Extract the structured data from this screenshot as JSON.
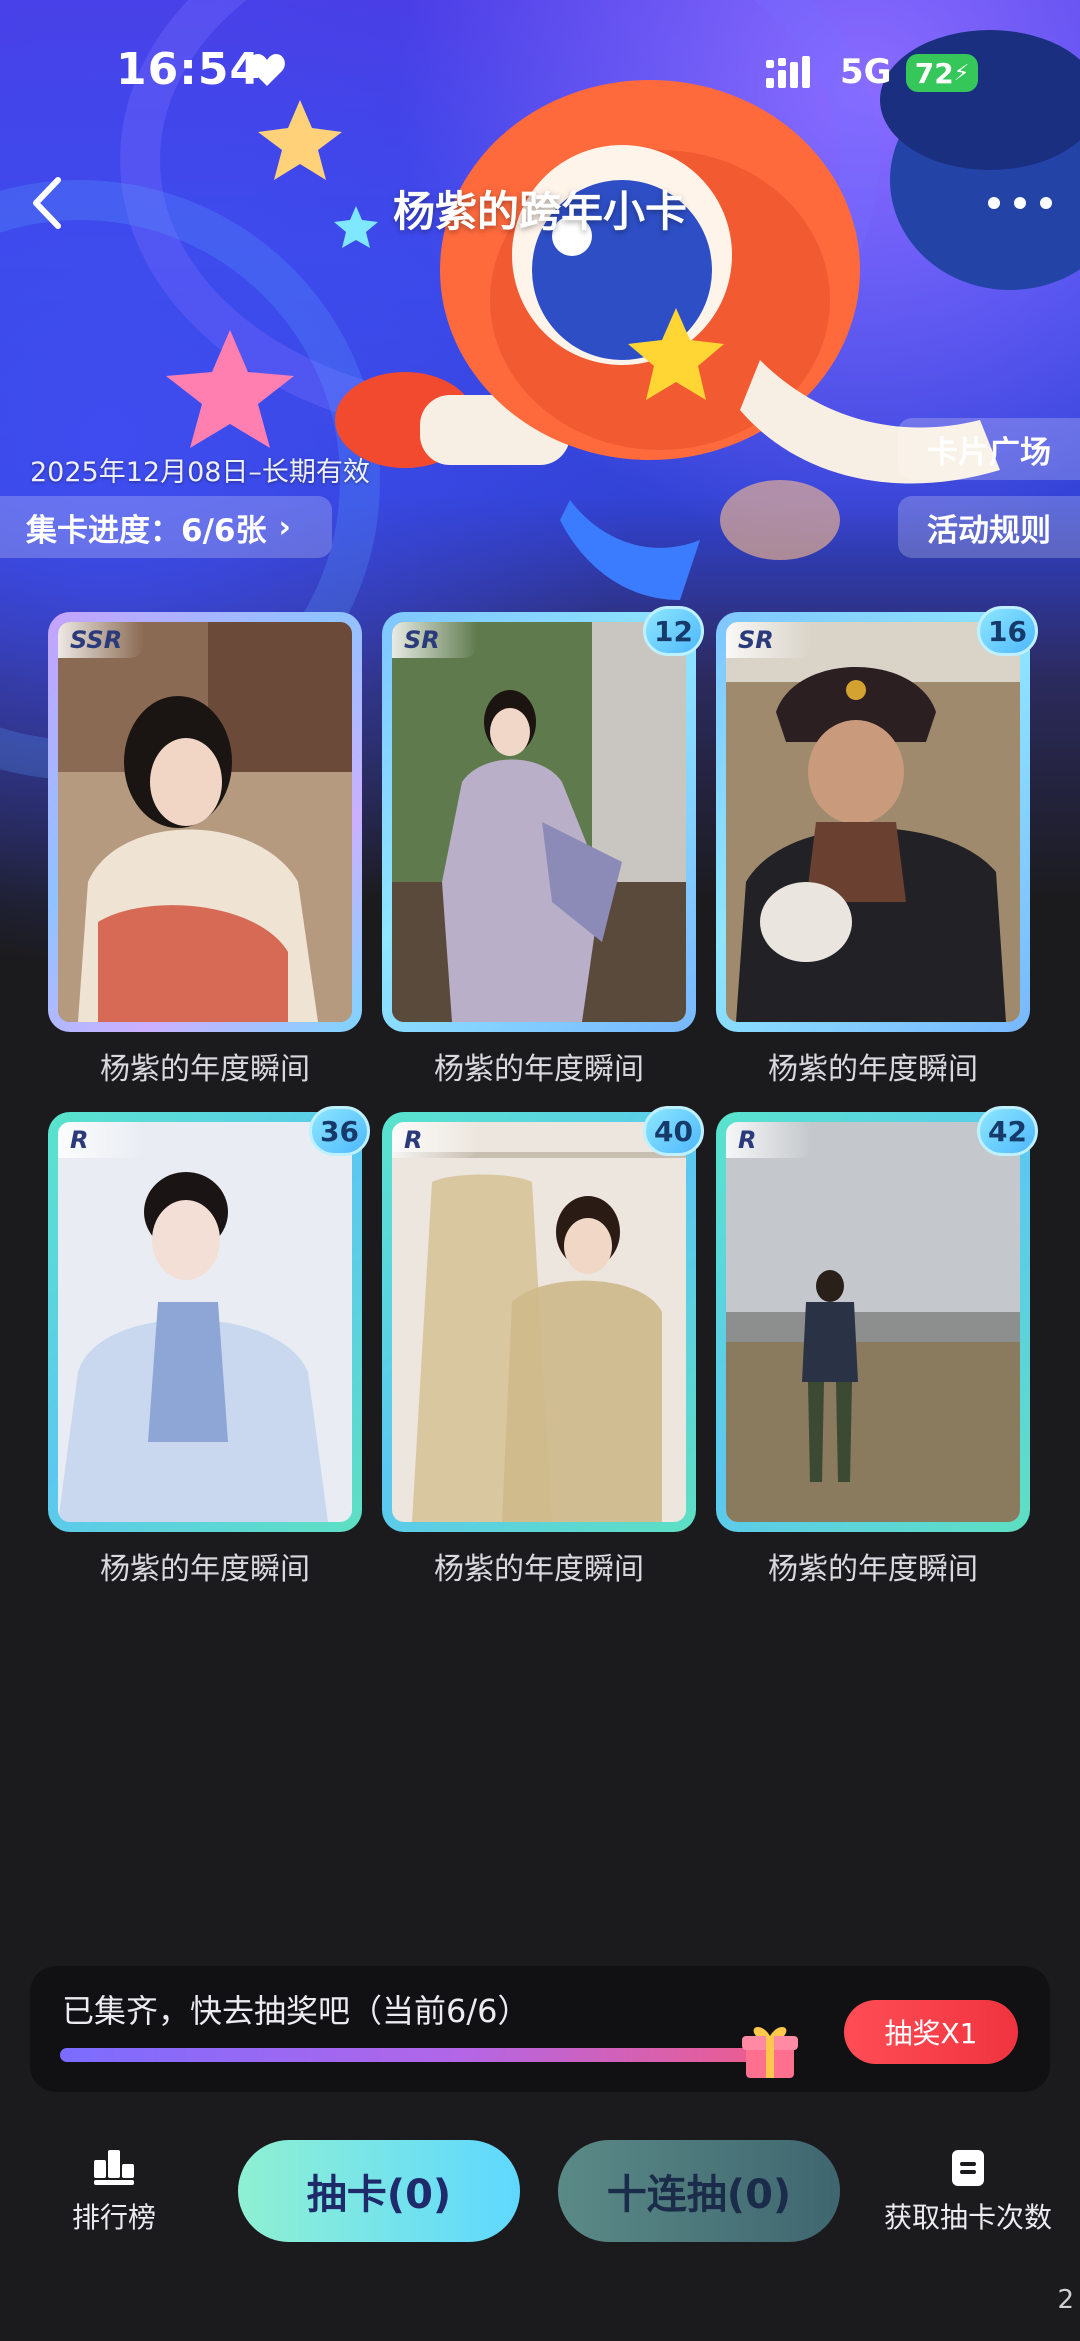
{
  "status_bar": {
    "time": "16:54",
    "network": "5G",
    "battery": "72"
  },
  "header": {
    "title": "杨紫的跨年小卡"
  },
  "banner": {
    "validity": "2025年12月08日–长期有效",
    "progress_label": "集卡进度：6/6张",
    "card_plaza": "卡片广场",
    "rules": "活动规则"
  },
  "cards": [
    {
      "rarity": "SSR",
      "count": "",
      "caption": "杨紫的年度瞬间"
    },
    {
      "rarity": "SR",
      "count": "12",
      "caption": "杨紫的年度瞬间"
    },
    {
      "rarity": "SR",
      "count": "16",
      "caption": "杨紫的年度瞬间"
    },
    {
      "rarity": "R",
      "count": "36",
      "caption": "杨紫的年度瞬间"
    },
    {
      "rarity": "R",
      "count": "40",
      "caption": "杨紫的年度瞬间"
    },
    {
      "rarity": "R",
      "count": "42",
      "caption": "杨紫的年度瞬间"
    }
  ],
  "collect": {
    "message": "已集齐，快去抽奖吧（当前6/6）",
    "progress_fraction": 1.0,
    "lottery_button": "抽奖X1"
  },
  "bottom_nav": {
    "ranking": "排行榜",
    "draw_one": "抽卡(0)",
    "draw_ten": "十连抽(0)",
    "get_draws": "获取抽卡次数"
  },
  "corner_digit": "2",
  "colors": {
    "accent_red": "#f0343f",
    "card_r": "#59e3cc",
    "card_sr": "#7fc6ff",
    "card_ssr": "#c6a3ff"
  }
}
